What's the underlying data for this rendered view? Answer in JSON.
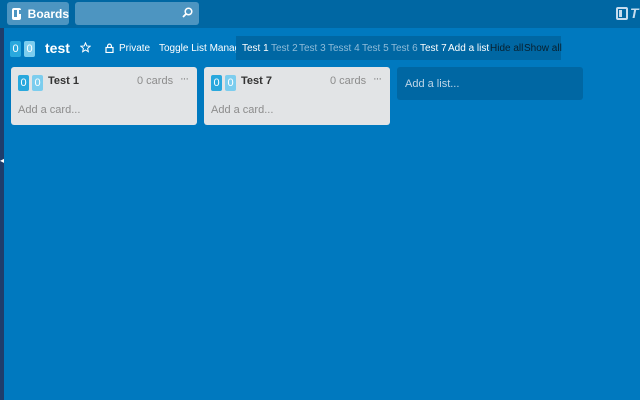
{
  "header": {
    "boards_label": "Boards",
    "search_placeholder": "",
    "logo_text": "T"
  },
  "board": {
    "badge_a": "0",
    "badge_b": "0",
    "title": "test",
    "privacy": "Private",
    "toggle_label": "Toggle List Manager"
  },
  "list_manager": {
    "items": [
      {
        "label": "Test 1",
        "state": "visible"
      },
      {
        "label": "Test 2",
        "state": "hidden"
      },
      {
        "label": "Test 3",
        "state": "hidden"
      },
      {
        "label": "Tesst 4",
        "state": "hidden"
      },
      {
        "label": "Test 5",
        "state": "hidden"
      },
      {
        "label": "Test 6",
        "state": "hidden"
      },
      {
        "label": "Test 7",
        "state": "visible"
      }
    ],
    "add_list": "Add a list",
    "hide_all": "Hide all",
    "show_all": "Show all"
  },
  "lists": [
    {
      "badge_a": "0",
      "badge_b": "0",
      "name": "Test 1",
      "count": "0 cards",
      "menu": "···",
      "add_card": "Add a card..."
    },
    {
      "badge_a": "0",
      "badge_b": "0",
      "name": "Test 7",
      "count": "0 cards",
      "menu": "···",
      "add_card": "Add a card..."
    }
  ],
  "add_list_label": "Add a list...",
  "colors": {
    "background": "#0079bf",
    "header": "#0067a3",
    "list": "#e2e4e6",
    "badge_dark": "#29a8dd",
    "badge_light": "#7ccdee"
  }
}
